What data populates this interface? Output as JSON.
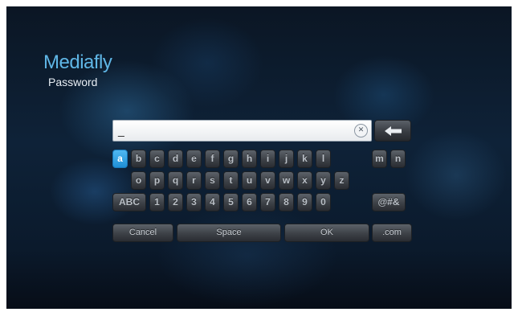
{
  "app": {
    "title": "Mediafly"
  },
  "field": {
    "label": "Password",
    "value": "_"
  },
  "keyboard": {
    "row1": [
      "a",
      "b",
      "c",
      "d",
      "e",
      "f",
      "g",
      "h",
      "i",
      "j",
      "k",
      "l",
      "m",
      "n"
    ],
    "row2": [
      "o",
      "p",
      "q",
      "r",
      "s",
      "t",
      "u",
      "v",
      "w",
      "x",
      "y",
      "z"
    ],
    "row3": [
      "ABC",
      "1",
      "2",
      "3",
      "4",
      "5",
      "6",
      "7",
      "8",
      "9",
      "0",
      "@#&"
    ],
    "row4": [
      "Cancel",
      "Space",
      "OK",
      ".com"
    ],
    "selected": "a"
  },
  "colors": {
    "accent": "#2a9de0",
    "title": "#5fb6e6"
  }
}
